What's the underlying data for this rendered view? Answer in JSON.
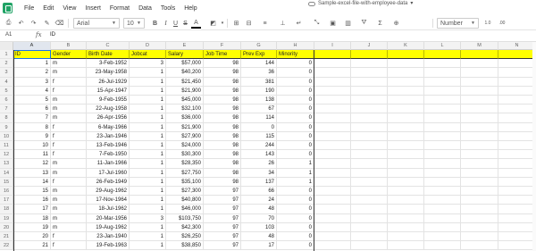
{
  "menu": [
    "File",
    "Edit",
    "View",
    "Insert",
    "Format",
    "Data",
    "Tools",
    "Help"
  ],
  "document_title": "Sample-excel-file-with-employee-data",
  "toolbar": {
    "font": "Arial",
    "font_size": "10",
    "bold": "B",
    "italic": "I",
    "underline": "U",
    "strike": "S",
    "format": "Number",
    "decimal": "1.0",
    "decimal2": ".00"
  },
  "formula_bar": {
    "cell_ref": "A1",
    "fx": "fx",
    "value": "ID"
  },
  "columns": [
    "A",
    "B",
    "C",
    "D",
    "E",
    "F",
    "G",
    "H",
    "I",
    "J",
    "K",
    "L",
    "M",
    "N"
  ],
  "header_row": [
    "ID",
    "Gender",
    "Birth Date",
    "Jobcat",
    "Salary",
    "Job Time",
    "Prev Exp",
    "Minority"
  ],
  "rows": [
    [
      "1",
      "m",
      "3-Feb-1952",
      "3",
      "$57,000",
      "98",
      "144",
      "0"
    ],
    [
      "2",
      "m",
      "23-May-1958",
      "1",
      "$40,200",
      "98",
      "36",
      "0"
    ],
    [
      "3",
      "f",
      "26-Jul-1929",
      "1",
      "$21,450",
      "98",
      "381",
      "0"
    ],
    [
      "4",
      "f",
      "15-Apr-1947",
      "1",
      "$21,900",
      "98",
      "190",
      "0"
    ],
    [
      "5",
      "m",
      "9-Feb-1955",
      "1",
      "$45,000",
      "98",
      "138",
      "0"
    ],
    [
      "6",
      "m",
      "22-Aug-1958",
      "1",
      "$32,100",
      "98",
      "67",
      "0"
    ],
    [
      "7",
      "m",
      "26-Apr-1956",
      "1",
      "$36,000",
      "98",
      "114",
      "0"
    ],
    [
      "8",
      "f",
      "6-May-1966",
      "1",
      "$21,900",
      "98",
      "0",
      "0"
    ],
    [
      "9",
      "f",
      "23-Jan-1946",
      "1",
      "$27,900",
      "98",
      "115",
      "0"
    ],
    [
      "10",
      "f",
      "13-Feb-1946",
      "1",
      "$24,000",
      "98",
      "244",
      "0"
    ],
    [
      "11",
      "f",
      "7-Feb-1950",
      "1",
      "$30,300",
      "98",
      "143",
      "0"
    ],
    [
      "12",
      "m",
      "11-Jan-1966",
      "1",
      "$28,350",
      "98",
      "26",
      "1"
    ],
    [
      "13",
      "m",
      "17-Jul-1960",
      "1",
      "$27,750",
      "98",
      "34",
      "1"
    ],
    [
      "14",
      "f",
      "26-Feb-1949",
      "1",
      "$35,100",
      "98",
      "137",
      "1"
    ],
    [
      "15",
      "m",
      "29-Aug-1962",
      "1",
      "$27,300",
      "97",
      "66",
      "0"
    ],
    [
      "16",
      "m",
      "17-Nov-1964",
      "1",
      "$40,800",
      "97",
      "24",
      "0"
    ],
    [
      "17",
      "m",
      "18-Jul-1962",
      "1",
      "$46,000",
      "97",
      "48",
      "0"
    ],
    [
      "18",
      "m",
      "20-Mar-1956",
      "3",
      "$103,750",
      "97",
      "70",
      "0"
    ],
    [
      "19",
      "m",
      "19-Aug-1962",
      "1",
      "$42,300",
      "97",
      "103",
      "0"
    ],
    [
      "20",
      "f",
      "23-Jan-1940",
      "1",
      "$26,250",
      "97",
      "48",
      "0"
    ],
    [
      "21",
      "f",
      "19-Feb-1963",
      "1",
      "$38,850",
      "97",
      "17",
      "0"
    ]
  ],
  "row_numbers": [
    "1",
    "2",
    "3",
    "4",
    "5",
    "6",
    "7",
    "8",
    "9",
    "10",
    "11",
    "12",
    "13",
    "14",
    "15",
    "16",
    "17",
    "18",
    "19",
    "20",
    "21",
    "22"
  ],
  "colors": {
    "header_fill": "#ffff00",
    "accent": "#21a366",
    "selection": "#1a73e8"
  }
}
